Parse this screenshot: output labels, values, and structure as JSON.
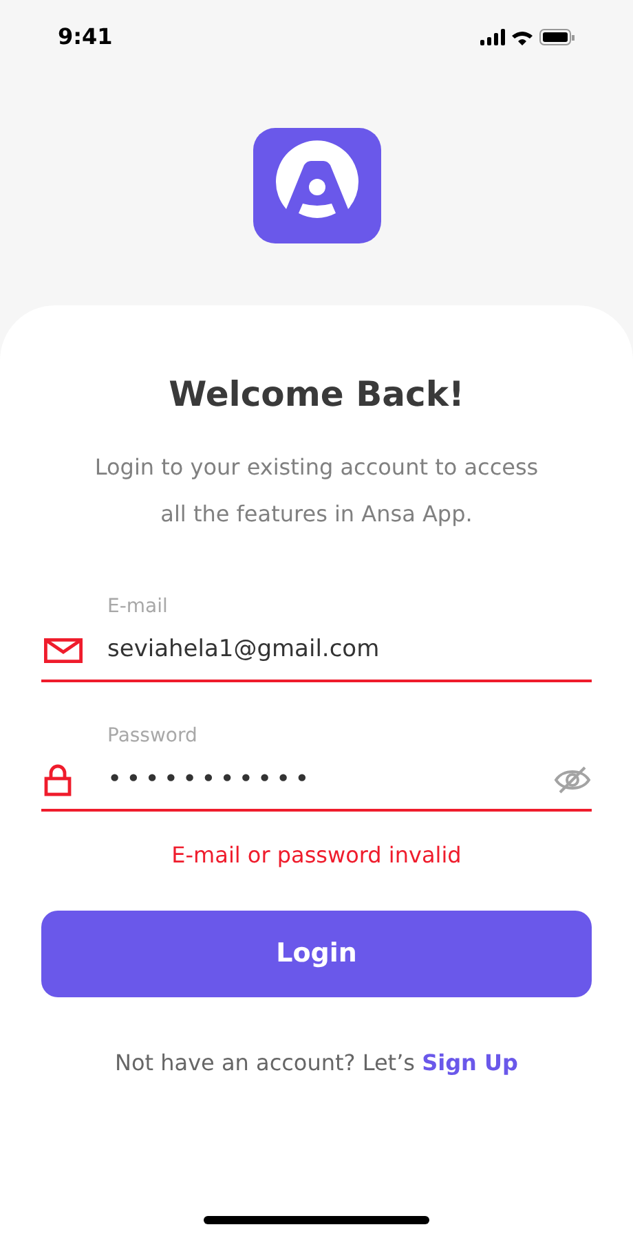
{
  "status_bar": {
    "time": "9:41"
  },
  "title": "Welcome Back!",
  "subtitle": "Login to your existing account to access all the features in Ansa App.",
  "fields": [
    {
      "kind": "email",
      "label": "E-mail",
      "value": "seviahela1@gmail.com",
      "error": true
    },
    {
      "kind": "password",
      "label": "Password",
      "value": "•••••••••••",
      "error": true
    }
  ],
  "error_message": "E-mail or password invalid",
  "login_button": "Login",
  "signup_prompt": {
    "text": "Not have an account? Let’s",
    "link": "Sign Up"
  }
}
